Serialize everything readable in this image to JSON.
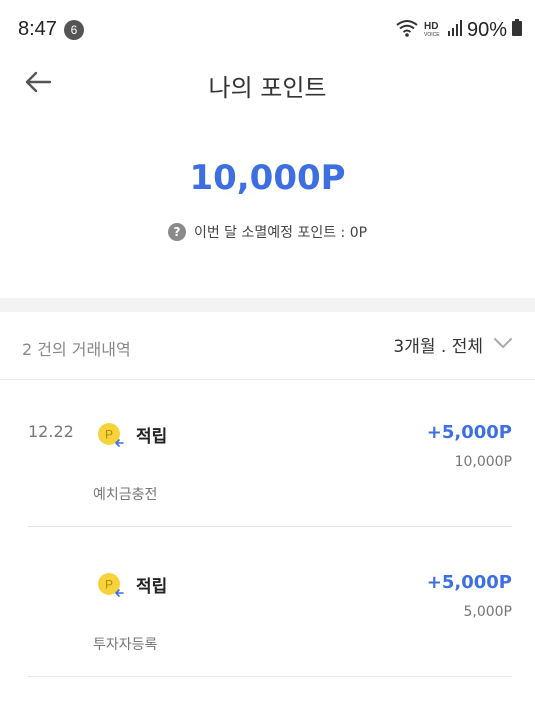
{
  "status_bar": {
    "time": "8:47",
    "notification_count": "6",
    "battery": "90%",
    "icons": [
      "wifi-icon",
      "hd-voice-icon",
      "signal-icon",
      "battery-icon"
    ]
  },
  "header": {
    "title": "나의 포인트",
    "back_icon": "arrow-left-icon"
  },
  "summary": {
    "balance": "10,000P",
    "expire_text": "이번 달 소멸예정 포인트 : 0P",
    "help_icon": "question-circle-icon"
  },
  "filter": {
    "count_text": "2 건의 거래내역",
    "period_label": "3개월 . 전체",
    "dropdown_icon": "chevron-down-icon"
  },
  "transactions": [
    {
      "date": "12.22",
      "type": "적립",
      "amount": "+5,000P",
      "balance": "10,000P",
      "description": "예치금충전"
    },
    {
      "date": "",
      "type": "적립",
      "amount": "+5,000P",
      "balance": "5,000P",
      "description": "투자자등록"
    }
  ],
  "colors": {
    "accent": "#3d6fe0",
    "coin": "#f6d33b",
    "divider": "#e6e6e6"
  }
}
